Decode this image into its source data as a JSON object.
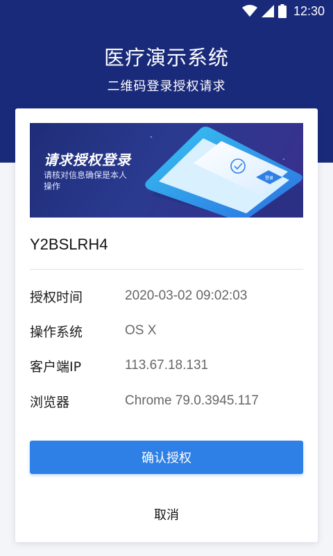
{
  "statusbar": {
    "time": "12:30"
  },
  "header": {
    "title": "医疗演示系统",
    "subtitle": "二维码登录授权请求"
  },
  "banner": {
    "title": "请求授权登录",
    "desc": "请核对信息确保是本人操作",
    "phone_button": "登录"
  },
  "device_code": "Y2BSLRH4",
  "info": [
    {
      "label": "授权时间",
      "value": "2020-03-02 09:02:03"
    },
    {
      "label": "操作系统",
      "value": "OS X"
    },
    {
      "label": "客户端IP",
      "value": "113.67.18.131"
    },
    {
      "label": "浏览器",
      "value": "Chrome 79.0.3945.117"
    }
  ],
  "actions": {
    "confirm": "确认授权",
    "cancel": "取消"
  },
  "colors": {
    "header_bg": "#1a2a7a",
    "primary": "#2f80e6"
  }
}
